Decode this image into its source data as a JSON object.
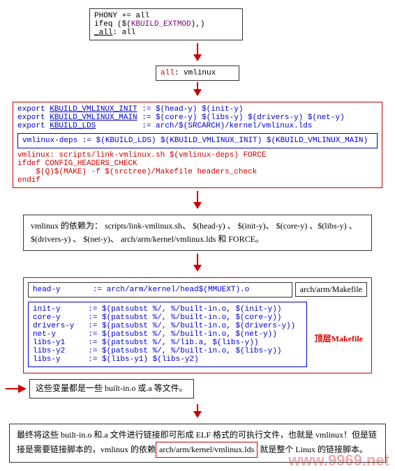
{
  "box1": {
    "line1": "PHONY += all",
    "line2a": "ifeq ($(",
    "line2b": "KBUILD_EXTMOD",
    "line2c": "),)",
    "line3a": "_all",
    "line3b": ": all"
  },
  "box2": {
    "target": "all",
    "dep": ": vmlinux"
  },
  "box3": {
    "l1a": "export ",
    "l1b": "KBUILD_VMLINUX_INIT",
    "l1c": " := $(head-y) $(init-y)",
    "l2a": "export ",
    "l2b": "KBUILD_VMLINUX_MAIN",
    "l2c": " := $(core-y) $(libs-y) $(drivers-y) $(net-y)",
    "l3a": "export ",
    "l3b": "KBUILD_LDS",
    "l3c": "          := arch/$(SRCARCH)/kernel/vmlinux.lds",
    "deps": "vmlinux-deps := $(KBUILD_LDS) $(KBUILD_VMLINUX_INIT) $(KBUILD_VMLINUX_MAIN)",
    "vm1": "vmlinux: scripts/link-vmlinux.sh $(vmlinux-deps) FORCE",
    "vm2": "ifdef CONFIG_HEADERS_CHECK",
    "vm3": "    $(Q)$(MAKE) -f $(srctree)/Makefile headers_check",
    "vm4": "endif"
  },
  "text1": "vmlinux 的依赖为：  scripts/link-vmlinux.sh、 $(head-y) 、 $(init-y)、  $(core-y) 、$(libs-y) 、  $(drivers-y) 、  $(net-y)、  arch/arm/kernel/vmlinux.lds  和  FORCE。",
  "box4": {
    "head": "head-y       := arch/arm/kernel/head$(MMUEXT).o",
    "head_label": "arch/arm/Makefile",
    "v1": "init-y      := $(patsubst %/, %/built-in.o, $(init-y))",
    "v2": "core-y      := $(patsubst %/, %/built-in.o, $(core-y))",
    "v3": "drivers-y   := $(patsubst %/, %/built-in.o, $(drivers-y))",
    "v4": "net-y       := $(patsubst %/, %/built-in.o, $(net-y))",
    "v5": "libs-y1     := $(patsubst %/, %/lib.a, $(libs-y))",
    "v6": "libs-y2     := $(patsubst %/, %/built-in.o, $(libs-y))",
    "v7": "libs-y      := $(libs-y1) $(libs-y2)",
    "top_label": "顶层Makefile"
  },
  "text2": "这些变量都是一些 built-in.o 或.a 等文件。",
  "text3a": "最终将这些 built-in.o 和.a 文件进行链接即可形成 ELF 格式的可执行文件，也就是 vmlinux！但是链接是需要链接脚本的，vmlinux 的依赖",
  "text3b": "arch/arm/kernel/vmlinux.lds",
  "text3c": " 就是整个 Linux 的链接脚本。",
  "watermark": "www.9969.net"
}
